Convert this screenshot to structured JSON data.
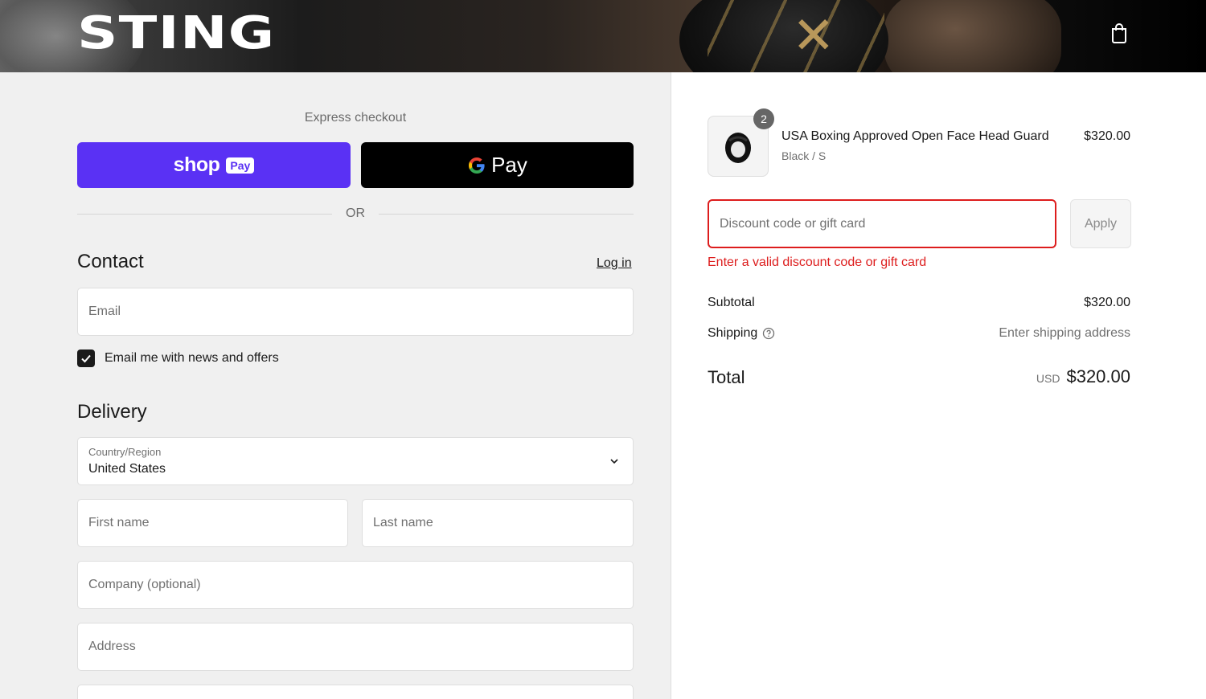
{
  "header": {
    "brand": "STING",
    "cart_icon": "shopping-bag-icon"
  },
  "express": {
    "title": "Express checkout",
    "shop_pay": {
      "word": "shop",
      "badge": "Pay"
    },
    "google_pay": {
      "word": "Pay"
    },
    "or_text": "OR"
  },
  "contact": {
    "heading": "Contact",
    "login_label": "Log in",
    "email_placeholder": "Email",
    "newsletter_label": "Email me with news and offers",
    "newsletter_checked": true
  },
  "delivery": {
    "heading": "Delivery",
    "country_label": "Country/Region",
    "country_value": "United States",
    "first_name_placeholder": "First name",
    "last_name_placeholder": "Last name",
    "company_placeholder": "Company (optional)",
    "address_placeholder": "Address"
  },
  "summary": {
    "item": {
      "quantity": "2",
      "name": "USA Boxing Approved Open Face Head Guard",
      "variant": "Black / S",
      "price": "$320.00"
    },
    "discount_placeholder": "Discount code or gift card",
    "apply_label": "Apply",
    "discount_error": "Enter a valid discount code or gift card",
    "subtotal_label": "Subtotal",
    "subtotal_value": "$320.00",
    "shipping_label": "Shipping",
    "shipping_value": "Enter shipping address",
    "total_label": "Total",
    "total_currency": "USD",
    "total_value": "$320.00"
  },
  "colors": {
    "shop_pay": "#5a31f4",
    "error": "#dd1d1d",
    "left_bg": "#f0f0f0"
  }
}
